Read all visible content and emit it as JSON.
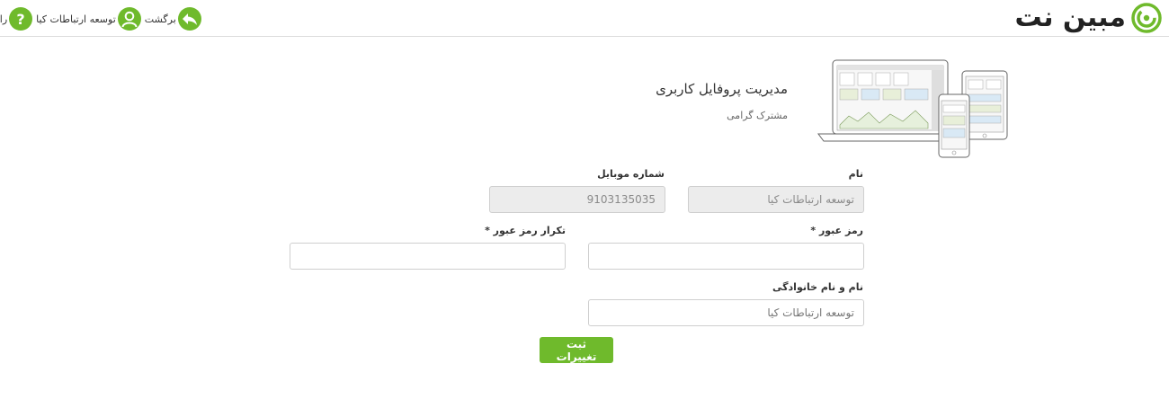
{
  "brand": {
    "name": "مبین نت",
    "accent": "#6fba2c"
  },
  "topbar": {
    "back_label": "برگشت",
    "user_label": "توسعه ارتباطات کیا",
    "help_label": "راه",
    "icons": [
      "back-arrow-icon",
      "user-icon",
      "help-icon"
    ]
  },
  "header": {
    "title": "مدیریت پروفایل کاربری",
    "subtitle": "مشترک گرامی"
  },
  "form": {
    "name": {
      "label": "نام",
      "value": "توسعه ارتباطات کیا"
    },
    "mobile": {
      "label": "شماره موبایل",
      "value": "9103135035"
    },
    "password": {
      "label": "رمز عبور *",
      "value": ""
    },
    "password_repeat": {
      "label": "تکرار رمز عبور *",
      "value": ""
    },
    "full_name": {
      "label": "نام و نام خانوادگی",
      "value": "توسعه ارتباطات کیا"
    },
    "submit_label": "ثبت تغییرات"
  }
}
